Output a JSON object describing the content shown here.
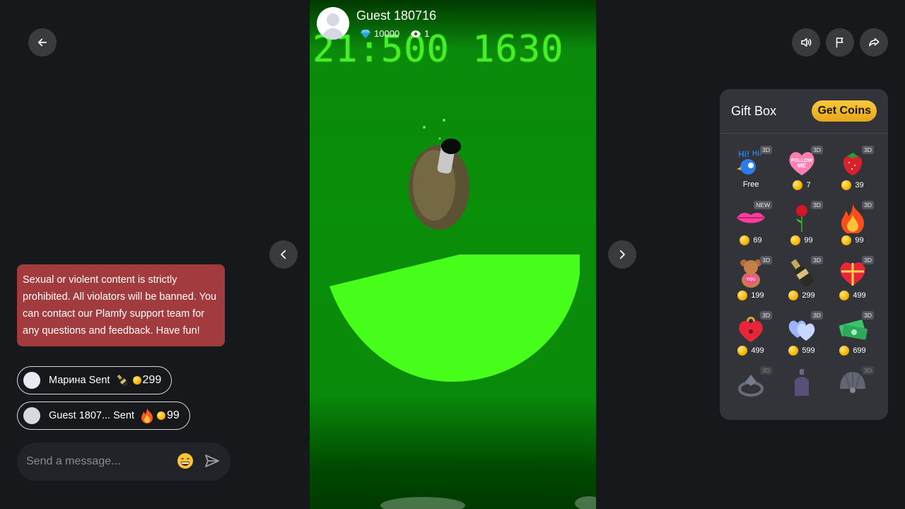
{
  "host": {
    "name": "Guest 180716",
    "diamonds": "10000",
    "viewers": "1"
  },
  "stream": {
    "overlay_text": "21:500 1630"
  },
  "notice": "Sexual or violent content is strictly prohibited. All violators will be banned. You can contact our Plamfy support team for any questions and feedback. Have fun!",
  "chat": [
    {
      "user": "Марина",
      "action": "Sent",
      "gift_icon": "champagne-icon",
      "amount": "299"
    },
    {
      "user": "Guest 1807...",
      "action": "Sent",
      "gift_icon": "fire-icon",
      "amount": "99"
    }
  ],
  "message_input": {
    "placeholder": "Send a message..."
  },
  "giftbox": {
    "title": "Gift Box",
    "get_coins": "Get Coins",
    "items": [
      {
        "icon": "hi-bird-icon",
        "badge": "3D",
        "price": "Free",
        "free": true
      },
      {
        "icon": "follow-me-heart-icon",
        "badge": "3D",
        "price": "7"
      },
      {
        "icon": "strawberry-icon",
        "badge": "3D",
        "price": "39"
      },
      {
        "icon": "lips-icon",
        "badge": "NEW",
        "price": "69"
      },
      {
        "icon": "rose-icon",
        "badge": "3D",
        "price": "99"
      },
      {
        "icon": "fire-icon",
        "badge": "3D",
        "price": "99"
      },
      {
        "icon": "love-bear-icon",
        "badge": "3D",
        "price": "199"
      },
      {
        "icon": "champagne-icon",
        "badge": "3D",
        "price": "299"
      },
      {
        "icon": "gift-heart-icon",
        "badge": "3D",
        "price": "499"
      },
      {
        "icon": "heart-lock-icon",
        "badge": "3D",
        "price": "499"
      },
      {
        "icon": "double-heart-icon",
        "badge": "3D",
        "price": "599"
      },
      {
        "icon": "money-icon",
        "badge": "3D",
        "price": "699"
      },
      {
        "icon": "ring-icon",
        "badge": "3D",
        "price": ""
      },
      {
        "icon": "perfume-icon",
        "badge": "",
        "price": ""
      },
      {
        "icon": "shell-icon",
        "badge": "3D",
        "price": ""
      }
    ]
  },
  "colors": {
    "background": "#17181b",
    "notice_bg": "#a23b3e",
    "accent_gold": "#f2bb2e",
    "stream_green": "#4af52a"
  }
}
